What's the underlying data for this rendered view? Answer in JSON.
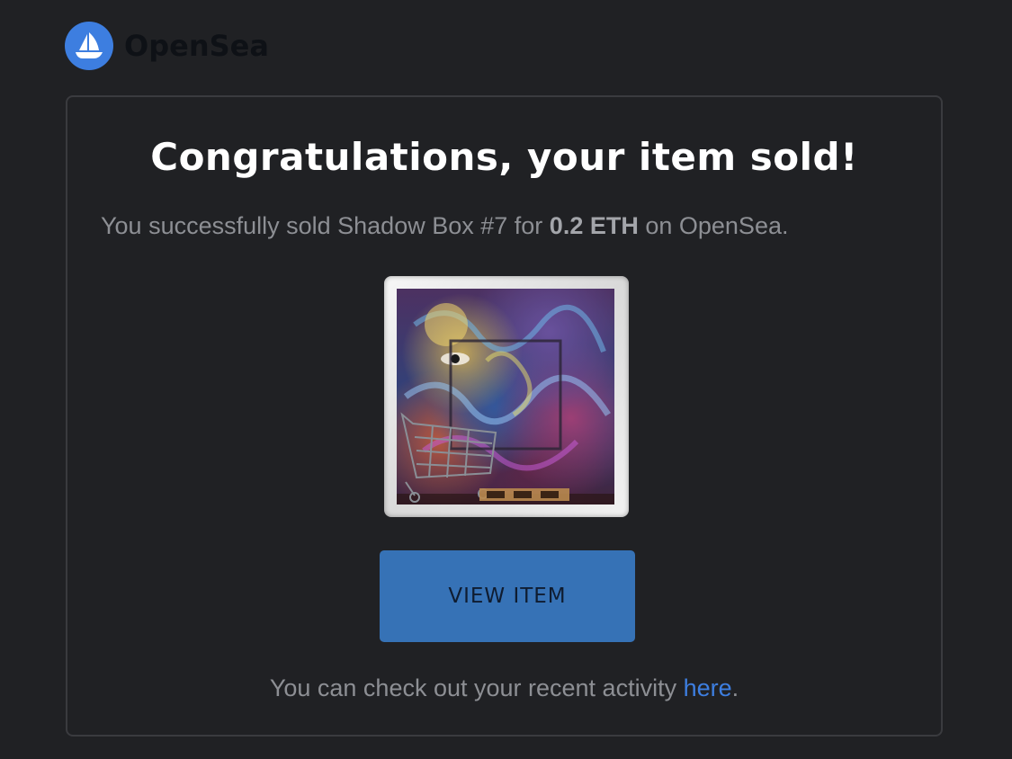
{
  "header": {
    "brand": "OpenSea",
    "logo_icon": "opensea-ship-icon",
    "logo_color": "#3d7ee0"
  },
  "card": {
    "title": "Congratulations, your item sold!",
    "message_prefix": "You successfully sold Shadow Box #7 for ",
    "amount": "0.2 ETH",
    "message_suffix": " on OpenSea.",
    "button_label": "VIEW ITEM",
    "button_color": "#3672b6",
    "footer_prefix": "You can check out your recent activity ",
    "footer_link": "here",
    "footer_suffix": "."
  }
}
